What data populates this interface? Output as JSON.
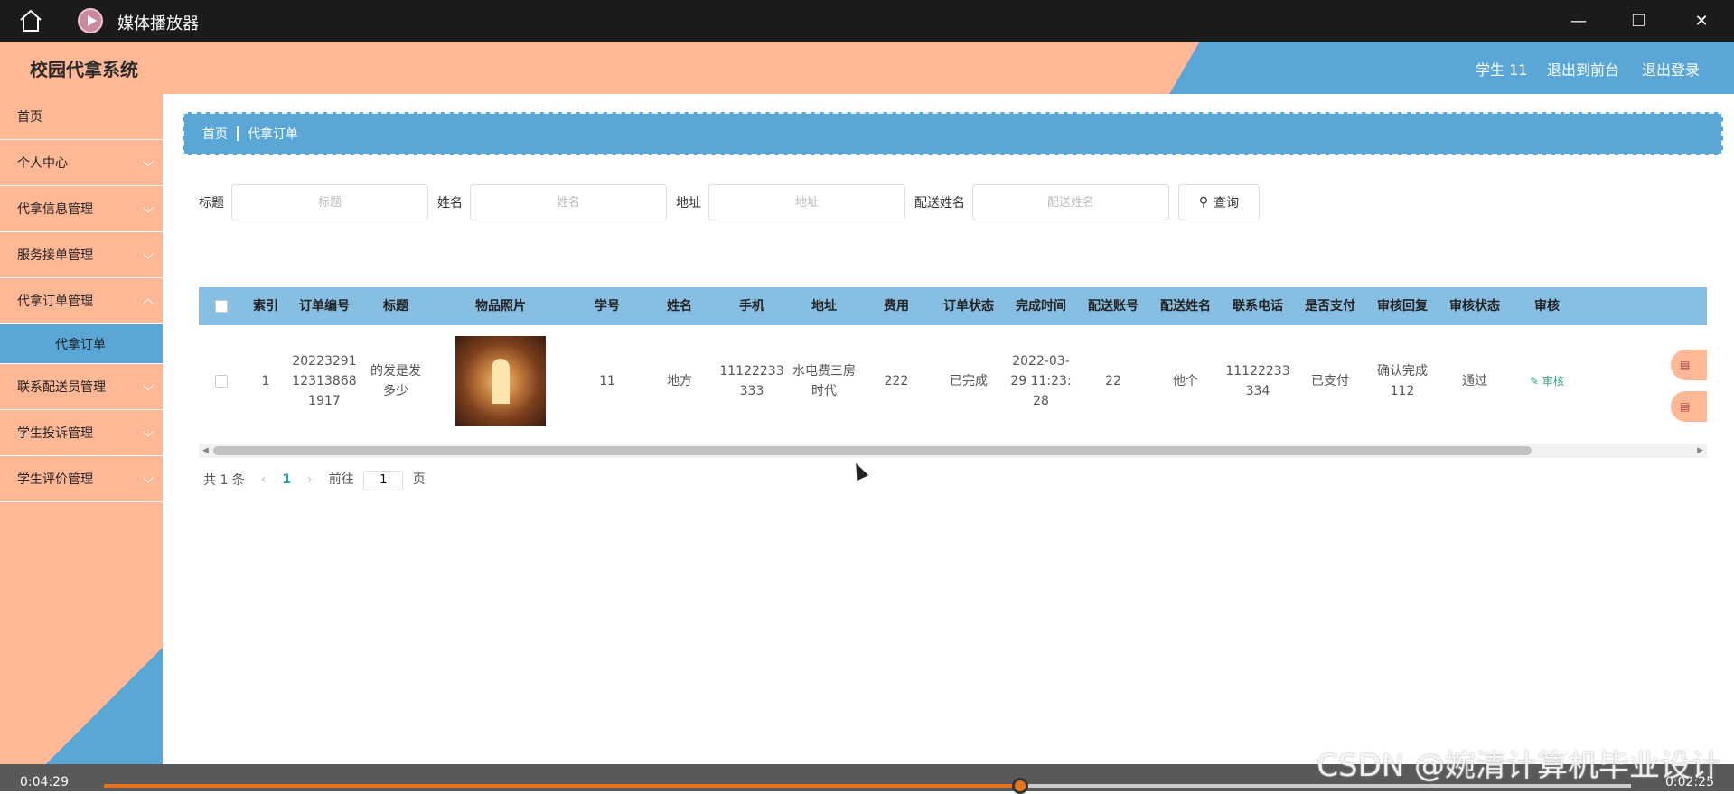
{
  "player": {
    "title": "媒体播放器",
    "elapsed": "0:04:29",
    "remaining": "0:02:25",
    "progress_fraction": 0.6
  },
  "header": {
    "brand": "校园代拿系统",
    "user": "学生 11",
    "to_front": "退出到前台",
    "logout": "退出登录"
  },
  "sidebar": {
    "items": [
      {
        "label": "首页",
        "expandable": false
      },
      {
        "label": "个人中心",
        "expandable": true
      },
      {
        "label": "代拿信息管理",
        "expandable": true
      },
      {
        "label": "服务接单管理",
        "expandable": true
      },
      {
        "label": "代拿订单管理",
        "expandable": true
      },
      {
        "label": "联系配送员管理",
        "expandable": true
      },
      {
        "label": "学生投诉管理",
        "expandable": true
      },
      {
        "label": "学生评价管理",
        "expandable": true
      }
    ],
    "active_sub": "代拿订单"
  },
  "breadcrumb": {
    "home": "首页",
    "current": "代拿订单"
  },
  "search": {
    "fields": [
      {
        "label": "标题",
        "placeholder": "标题"
      },
      {
        "label": "姓名",
        "placeholder": "姓名"
      },
      {
        "label": "地址",
        "placeholder": "地址"
      },
      {
        "label": "配送姓名",
        "placeholder": "配送姓名"
      }
    ],
    "button": "查询"
  },
  "table": {
    "columns": [
      "索引",
      "订单编号",
      "标题",
      "物品照片",
      "学号",
      "姓名",
      "手机",
      "地址",
      "费用",
      "订单状态",
      "完成时间",
      "配送账号",
      "配送姓名",
      "联系电话",
      "是否支付",
      "审核回复",
      "审核状态",
      "审核"
    ],
    "rows": [
      {
        "index": "1",
        "order_no": "20223291123138681917",
        "title": "的发是发多少",
        "student_no": "11",
        "name": "地方",
        "phone": "11122233333",
        "address": "水电费三房时代",
        "fee": "222",
        "status": "已完成",
        "finish_time": "2022-03-29 11:23:28",
        "courier_account": "22",
        "courier_name": "他个",
        "contact": "11122233334",
        "paid": "已支付",
        "review_reply": "确认完成112",
        "review_status": "通过",
        "audit_action": "审核"
      }
    ]
  },
  "pagination": {
    "total": "共 1 条",
    "current_page": "1",
    "goto_label": "前往",
    "goto_value": "1",
    "page_suffix": "页"
  },
  "watermark": "CSDN @婉清计算机毕业设计"
}
